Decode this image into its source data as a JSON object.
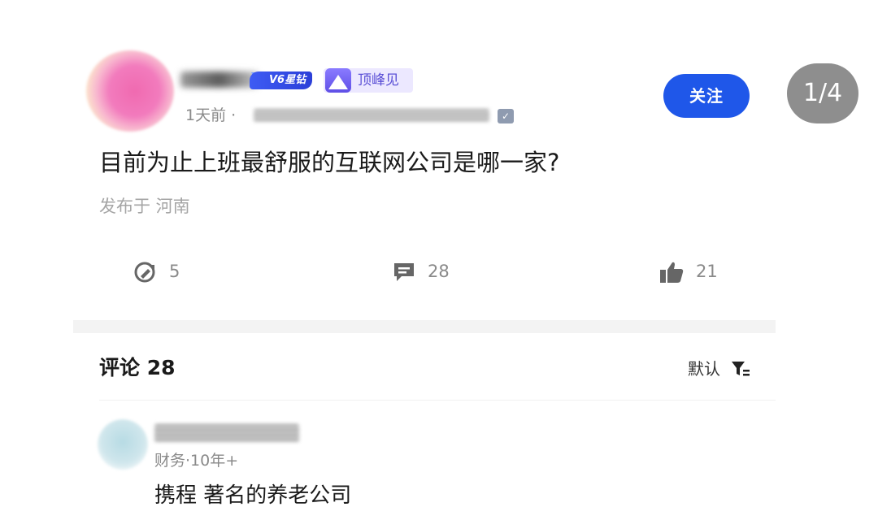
{
  "post": {
    "author": {
      "level_badge": "V6星钻",
      "title_badge": "顶峰见",
      "time": "1天前 ·",
      "verified_mark": "✓"
    },
    "follow_label": "关注",
    "page_indicator": "1/4",
    "question": "目前为止上班最舒服的互联网公司是哪一家?",
    "location": "发布于 河南",
    "stats": {
      "forwards": "5",
      "comments": "28",
      "likes": "21"
    }
  },
  "comments": {
    "title": "评论 28",
    "sort_label": "默认",
    "items": [
      {
        "meta": "财务·10年+",
        "text": "携程 著名的养老公司"
      }
    ]
  },
  "icons": {
    "forward": "edit-circle-icon",
    "comment": "comment-icon",
    "like": "thumbs-up-icon",
    "sort": "filter-sort-icon"
  }
}
